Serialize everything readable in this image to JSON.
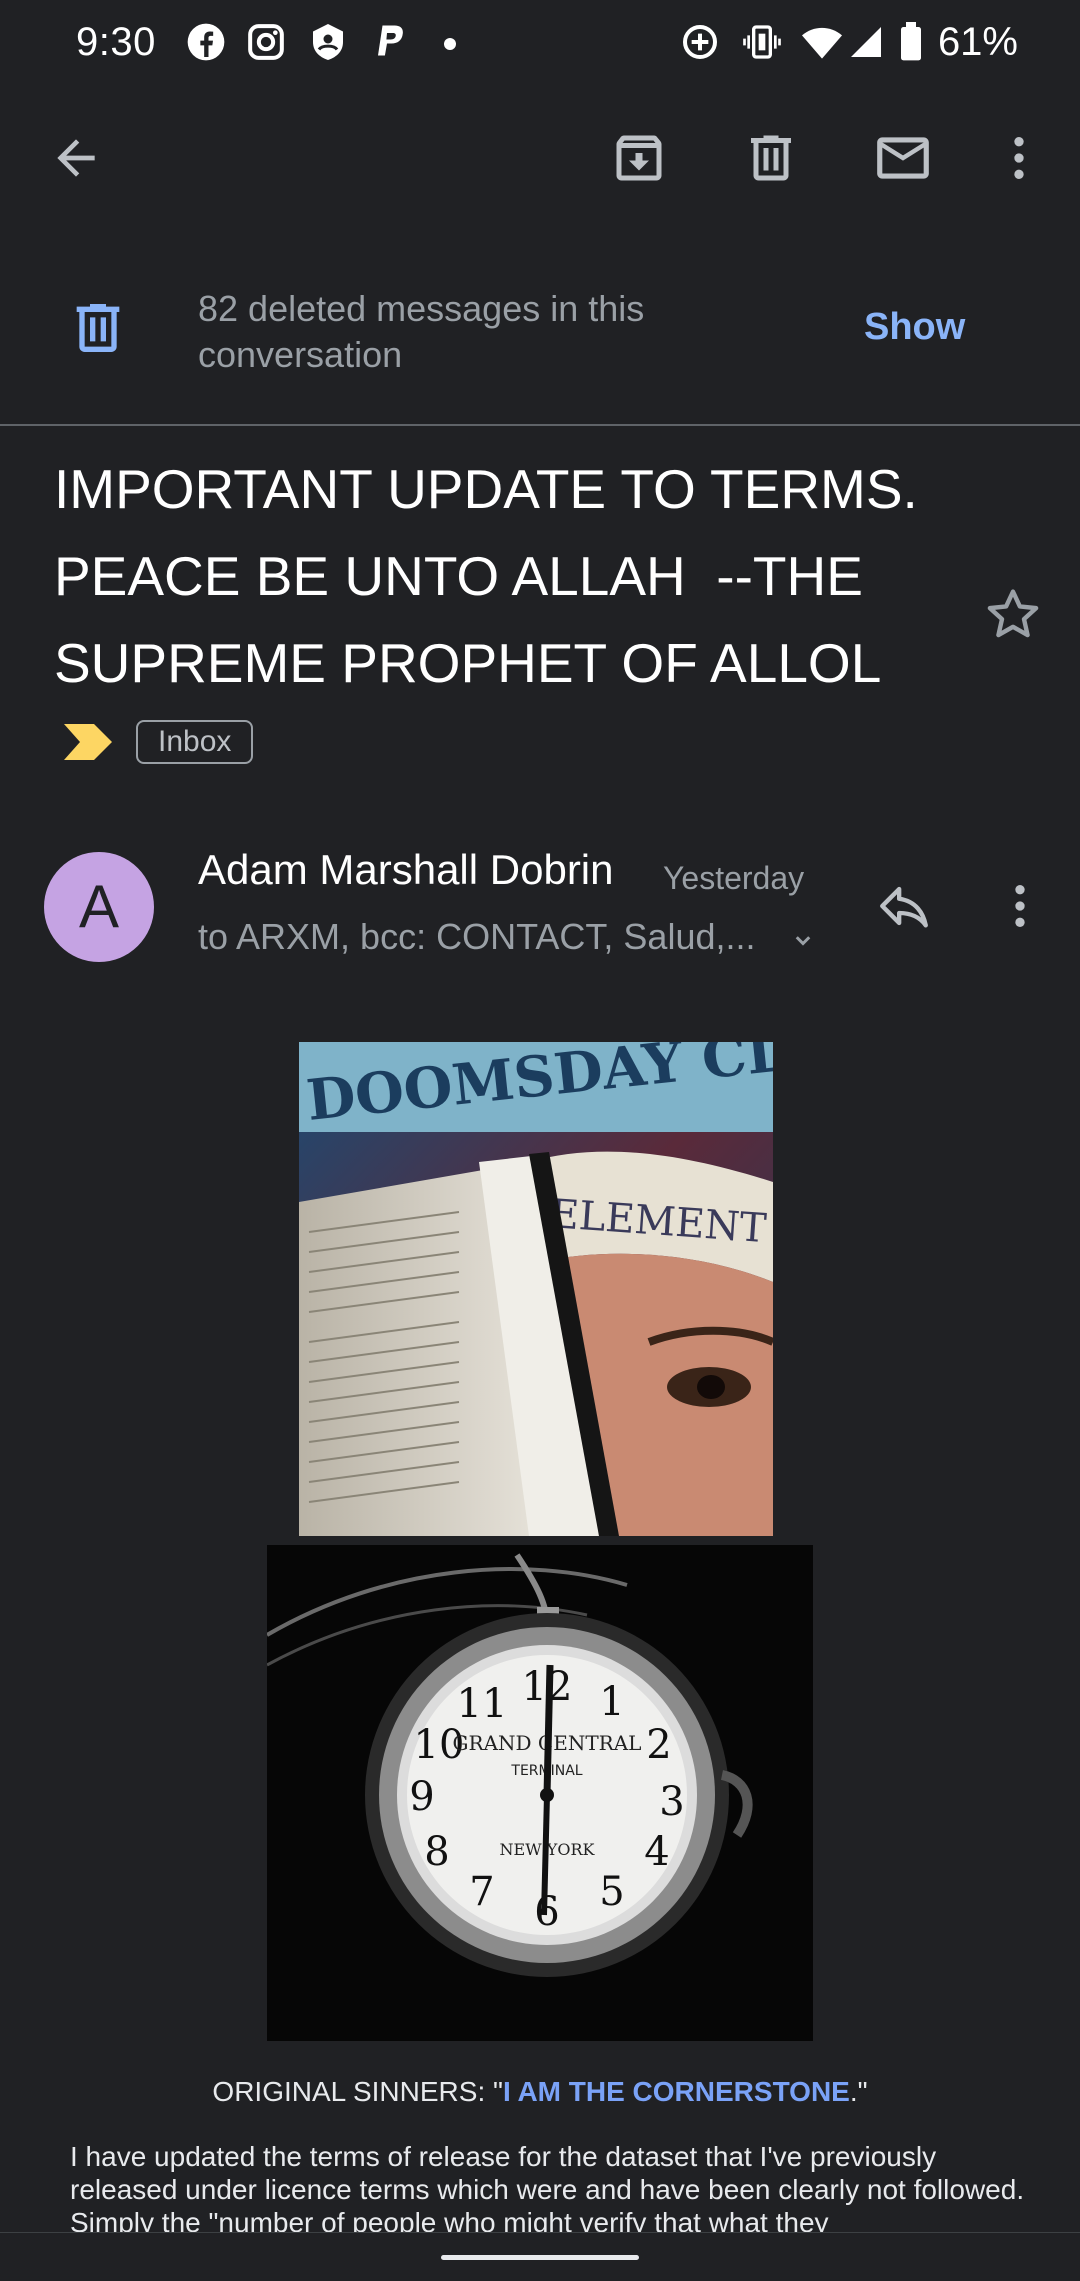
{
  "status_bar": {
    "time": "9:30",
    "battery": "61%",
    "left_icons": [
      "facebook-icon",
      "instagram-icon",
      "app-icon",
      "paypal-icon",
      "dot-icon"
    ],
    "right_icons": [
      "data-saver-icon",
      "vibrate-icon",
      "wifi-icon",
      "signal-icon",
      "battery-icon"
    ]
  },
  "toolbar": {
    "icons": [
      "back-arrow-icon",
      "archive-icon",
      "delete-icon",
      "mark-unread-icon",
      "more-vert-icon"
    ]
  },
  "banner": {
    "text": "82 deleted messages in this conversation",
    "action": "Show"
  },
  "subject": {
    "line1": "IMPORTANT UPDATE TO TERMS.",
    "line2": "PEACE BE UNTO ALLAH  --THE",
    "line3": "SUPREME PROPHET OF ALLOL",
    "label": "Inbox",
    "importance_color": "#fdd663"
  },
  "message": {
    "avatar_letter": "A",
    "avatar_color": "#c5a3e3",
    "sender": "Adam Marshall Dobrin",
    "date": "Yesterday",
    "recipients": "to ARXM, bcc: CONTACT, Salud,..."
  },
  "images": {
    "img1_text_top": "DOOMSDAY CLOCK",
    "img1_text_cap": "ELEMENT",
    "img2_clock_arc": "GRAND CENTRAL",
    "img2_clock_mid": "TERMINAL",
    "img2_clock_bottom": "NEW YORK"
  },
  "body": {
    "prefix": "ORIGINAL SINNERS: \"",
    "link": "I AM THE CORNERSTONE",
    "suffix": ".\"",
    "paragraph": "I have updated the terms of release for the dataset that I've previously released under licence terms which were and have been clearly not followed.  Simply the \"number of people who might verify that what they"
  },
  "colors": {
    "background": "#202124",
    "accent": "#8ab4f8",
    "link": "#7aa2f7"
  }
}
